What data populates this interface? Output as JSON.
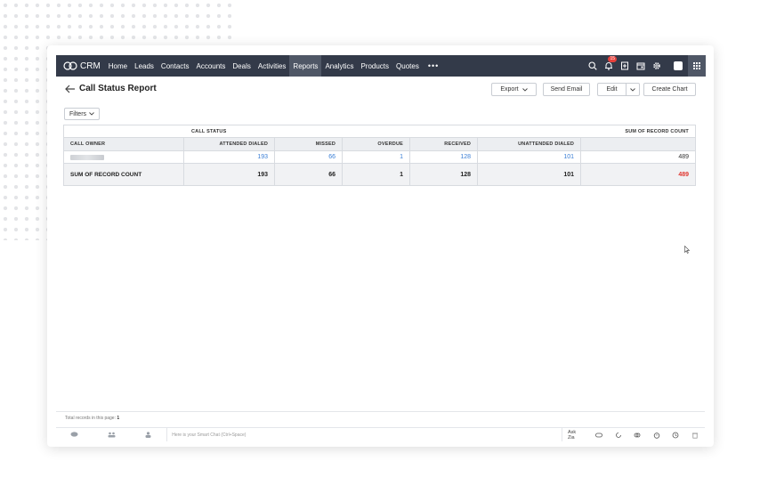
{
  "nav": {
    "brand": "CRM",
    "items": [
      "Home",
      "Leads",
      "Contacts",
      "Accounts",
      "Deals",
      "Activities",
      "Reports",
      "Analytics",
      "Products",
      "Quotes"
    ],
    "active": "Reports",
    "more": "•••",
    "notification_count": "15",
    "icons": [
      "search-icon",
      "bell-icon",
      "add-record-icon",
      "calendar-icon",
      "gear-icon",
      "avatar",
      "apps-grid-icon"
    ]
  },
  "header": {
    "title": "Call Status Report",
    "export_label": "Export",
    "send_email_label": "Send Email",
    "edit_label": "Edit",
    "create_chart_label": "Create Chart"
  },
  "filters": {
    "label": "Filters"
  },
  "table": {
    "group_header": "CALL STATUS",
    "sum_header": "SUM OF RECORD COUNT",
    "columns": [
      "CALL OWNER",
      "ATTENDED DIALED",
      "MISSED",
      "OVERDUE",
      "RECEIVED",
      "UNATTENDED DIALED"
    ],
    "rows": [
      {
        "owner": "",
        "values": [
          "193",
          "66",
          "1",
          "128",
          "101"
        ],
        "sum": "489"
      }
    ],
    "totals": {
      "label": "SUM OF RECORD COUNT",
      "values": [
        "193",
        "66",
        "1",
        "128",
        "101"
      ],
      "sum": "489"
    }
  },
  "footer": {
    "total_records_label": "Total records in this page:",
    "total_records_value": "1",
    "smart_chat_placeholder": "Here is your Smart Chat (Ctrl+Space)",
    "ask_zia": "Ask Zia"
  },
  "colors": {
    "nav_bg": "#333a49",
    "nav_active": "#4f5766",
    "link": "#3b7fd6",
    "total_highlight": "#e0362f"
  }
}
